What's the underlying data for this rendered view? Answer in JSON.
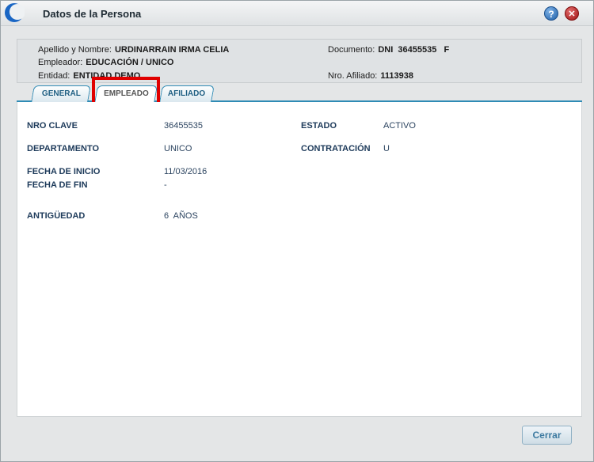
{
  "window": {
    "title": "Datos de la Persona",
    "help_label": "?",
    "close_label": "✕"
  },
  "header": {
    "nombre_label": "Apellido y Nombre:",
    "nombre_value": "URDINARRAIN IRMA CELIA",
    "documento_label": "Documento:",
    "documento_value": "DNI  36455535   F",
    "empleador_label": "Empleador:",
    "empleador_value": "EDUCACIÓN / UNICO",
    "entidad_label": "Entidad:",
    "entidad_value": "ENTIDAD DEMO",
    "afiliado_label": "Nro. Afiliado:",
    "afiliado_value": "1113938"
  },
  "tabs": [
    {
      "label": "GENERAL"
    },
    {
      "label": "EMPLEADO",
      "active": true
    },
    {
      "label": "AFILIADO"
    }
  ],
  "empleado": {
    "nro_clave_label": "NRO CLAVE",
    "nro_clave_value": "36455535",
    "estado_label": "ESTADO",
    "estado_value": "ACTIVO",
    "departamento_label": "DEPARTAMENTO",
    "departamento_value": "UNICO",
    "contratacion_label": "CONTRATACIÓN",
    "contratacion_value": "U",
    "fecha_inicio_label": "FECHA DE INICIO",
    "fecha_inicio_value": "11/03/2016",
    "fecha_fin_label": "FECHA DE FIN",
    "fecha_fin_value": "-",
    "antiguedad_label": "ANTIGÜEDAD",
    "antiguedad_value": "6  AÑOS"
  },
  "footer": {
    "cerrar_label": "Cerrar"
  },
  "colors": {
    "accent": "#2f8bb5",
    "highlight": "#e00000",
    "close": "#a11313",
    "help": "#1f5fa8"
  }
}
